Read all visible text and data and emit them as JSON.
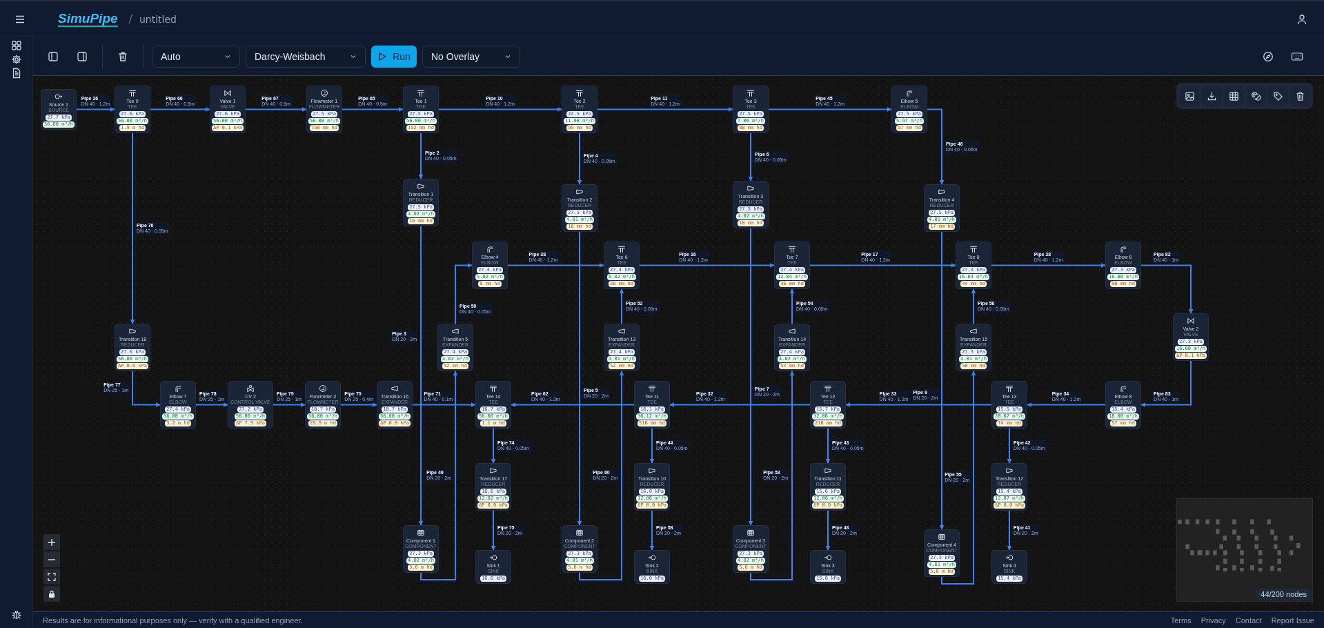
{
  "header": {
    "logo": "SimuPipe",
    "separator": "/",
    "document_title": "untitled"
  },
  "toolbar": {
    "solver_mode": "Auto",
    "friction_model": "Darcy-Weisbach",
    "run_button": "Run",
    "overlay": "No Overlay"
  },
  "nodes": [
    {
      "name": "Source 1",
      "type_label": "SOURCE",
      "kind": "source",
      "readings": [
        "27.7 kPa",
        "56.00 m³/h"
      ]
    },
    {
      "name": "Tee 9",
      "type_label": "TEE",
      "kind": "tee",
      "readings": [
        "27.6 kPa",
        "56.00 m³/h",
        "1.9 m hd"
      ]
    },
    {
      "name": "Valve 1",
      "type_label": "VALVE",
      "kind": "valve",
      "readings": [
        "27.6 kPa",
        "56.00 m³/h",
        "ΔP 0.1 kPa"
      ]
    },
    {
      "name": "Flowmeter 1",
      "type_label": "FLOWMETER",
      "kind": "flowmeter",
      "readings": [
        "27.5 kPa",
        "56.00 m³/h",
        "750 mm hd"
      ]
    },
    {
      "name": "Tee 1",
      "type_label": "TEE",
      "kind": "tee",
      "readings": [
        "27.5 kPa",
        "56.00 m³/h",
        "152 mm hd"
      ]
    },
    {
      "name": "Tee 2",
      "type_label": "TEE",
      "kind": "tee",
      "readings": [
        "22.5 kPa",
        "11.98 m³/h",
        "95 mm hd"
      ]
    },
    {
      "name": "Tee 3",
      "type_label": "TEE",
      "kind": "tee",
      "readings": [
        "27.5 kPa",
        "7.06 m³/h",
        "88 mm hd"
      ]
    },
    {
      "name": "Elbow 5",
      "type_label": "ELBOW",
      "kind": "elbow",
      "readings": [
        "27.5 kPa",
        "5.97 m³/h",
        "57 mm hd"
      ]
    },
    {
      "name": "Transition 1",
      "type_label": "REDUCER",
      "kind": "reducer",
      "readings": [
        "27.5 kPa",
        "4.02 m³/h",
        "16 mm hd"
      ]
    },
    {
      "name": "Transition 2",
      "type_label": "REDUCER",
      "kind": "reducer",
      "readings": [
        "27.5 kPa",
        "4.01 m³/h",
        "18 mm hd"
      ]
    },
    {
      "name": "Transition 3",
      "type_label": "REDUCER",
      "kind": "reducer",
      "readings": [
        "27.5 kPa",
        "4.02 m³/h",
        "18 mm hd"
      ]
    },
    {
      "name": "Transition 4",
      "type_label": "REDUCER",
      "kind": "reducer",
      "readings": [
        "27.5 kPa",
        "4.01 m³/h",
        "17 mm hd"
      ]
    },
    {
      "name": "Elbow 4",
      "type_label": "ELBOW",
      "kind": "elbow",
      "readings": [
        "27.4 kPa",
        "5.02 m³/h",
        "9 mm hd"
      ]
    },
    {
      "name": "Tee 6",
      "type_label": "TEE",
      "kind": "tee",
      "readings": [
        "27.4 kPa",
        "8.02 m³/h",
        "28 mm hd"
      ]
    },
    {
      "name": "Tee 7",
      "type_label": "TEE",
      "kind": "tee",
      "readings": [
        "27.4 kPa",
        "12.04 m³/h",
        "36 mm hd"
      ]
    },
    {
      "name": "Tee 8",
      "type_label": "TEE",
      "kind": "tee",
      "readings": [
        "27.3 kPa",
        "16.04 m³/h",
        "44 mm hd"
      ]
    },
    {
      "name": "Elbow 6",
      "type_label": "ELBOW",
      "kind": "elbow",
      "readings": [
        "27.3 kPa",
        "16.00 m³/h",
        "90 mm hd"
      ]
    },
    {
      "name": "Transition 18",
      "type_label": "REDUCER",
      "kind": "reducer",
      "readings": [
        "27.6 kPa",
        "56.00 m³/h",
        "ΔP 0.0 kPa"
      ]
    },
    {
      "name": "Transition 5",
      "type_label": "EXPANDER",
      "kind": "expander",
      "readings": [
        "27.4 kPa",
        "4.02 m³/h",
        "52 mm hd"
      ]
    },
    {
      "name": "Transition 13",
      "type_label": "EXPANDER",
      "kind": "expander",
      "readings": [
        "27.4 kPa",
        "4.01 m³/h",
        "52 mm hd"
      ]
    },
    {
      "name": "Transition 14",
      "type_label": "EXPANDER",
      "kind": "expander",
      "readings": [
        "27.4 kPa",
        "4.02 m³/h",
        "52 mm hd"
      ]
    },
    {
      "name": "Transition 15",
      "type_label": "EXPANDER",
      "kind": "expander",
      "readings": [
        "27.3 kPa",
        "4.01 m³/h",
        "50 mm hd"
      ]
    },
    {
      "name": "Valve 2",
      "type_label": "VALVE",
      "kind": "valve",
      "readings": [
        "27.3 kPa",
        "16.00 m³/h",
        "ΔP 0.1 kPa"
      ]
    },
    {
      "name": "Elbow 7",
      "type_label": "ELBOW",
      "kind": "elbow",
      "readings": [
        "27.4 kPa",
        "56.00 m³/h",
        "3.2 m hd"
      ]
    },
    {
      "name": "CV 2",
      "type_label": "CONTROL VALVE",
      "kind": "control_valve",
      "readings": [
        "27.2 kPa",
        "56.00 m³/h",
        "ΔP 7.9 kPa"
      ]
    },
    {
      "name": "Flowmeter 2",
      "type_label": "FLOWMETER",
      "kind": "flowmeter",
      "readings": [
        "18.7 kPa",
        "56.00 m³/h",
        "29.9 m hd"
      ]
    },
    {
      "name": "Transition 16",
      "type_label": "EXPANDER",
      "kind": "expander",
      "readings": [
        "18.7 kPa",
        "56.00 m³/h",
        "ΔP 0.0 kPa"
      ]
    },
    {
      "name": "Tee 14",
      "type_label": "TEE",
      "kind": "tee",
      "readings": [
        "16.7 kPa",
        "56.00 m³/h",
        "1.1 m hd"
      ]
    },
    {
      "name": "Tee 11",
      "type_label": "TEE",
      "kind": "tee",
      "readings": [
        "16.1 kPa",
        "36.12 m³/h",
        "516 mm hd"
      ]
    },
    {
      "name": "Tee 12",
      "type_label": "TEE",
      "kind": "tee",
      "readings": [
        "15.7 kPa",
        "32.06 m³/h",
        "216 mm hd"
      ]
    },
    {
      "name": "Tee 13",
      "type_label": "TEE",
      "kind": "tee",
      "readings": [
        "15.5 kPa",
        "20.07 m³/h",
        "74 mm hd"
      ]
    },
    {
      "name": "Elbow 8",
      "type_label": "ELBOW",
      "kind": "elbow",
      "readings": [
        "15.4 kPa",
        "16.00 m³/h",
        "57 mm hd"
      ]
    },
    {
      "name": "Transition 17",
      "type_label": "REDUCER",
      "kind": "reducer",
      "readings": [
        "16.6 kPa",
        "12.02 m³/h",
        "ΔP 0.0 kPa"
      ]
    },
    {
      "name": "Transition 10",
      "type_label": "REDUCER",
      "kind": "reducer",
      "readings": [
        "16.0 kPa",
        "12.06 m³/h",
        "ΔP 0.0 kPa"
      ]
    },
    {
      "name": "Transition 11",
      "type_label": "REDUCER",
      "kind": "reducer",
      "readings": [
        "15.6 kPa",
        "12.06 m³/h",
        "ΔP 0.0 kPa"
      ]
    },
    {
      "name": "Transition 12",
      "type_label": "REDUCER",
      "kind": "reducer",
      "readings": [
        "15.4 kPa",
        "12.07 m³/h",
        "ΔP 0.0 kPa"
      ]
    },
    {
      "name": "Component 1",
      "type_label": "COMPONENT",
      "kind": "component",
      "readings": [
        "27.3 kPa",
        "4.02 m³/h",
        "5.6 m hd"
      ]
    },
    {
      "name": "Sink 1",
      "type_label": "SINK",
      "kind": "sink",
      "readings": [
        "16.6 kPa"
      ]
    },
    {
      "name": "Component 2",
      "type_label": "COMPONENT",
      "kind": "component",
      "readings": [
        "27.3 kPa",
        "4.01 m³/h",
        "5.6 m hd"
      ]
    },
    {
      "name": "Sink 2",
      "type_label": "SINK",
      "kind": "sink",
      "readings": [
        "16.0 kPa"
      ]
    },
    {
      "name": "Component 3",
      "type_label": "COMPONENT",
      "kind": "component",
      "readings": [
        "27.3 kPa",
        "4.02 m³/h",
        "5.6 m hd"
      ]
    },
    {
      "name": "Sink 3",
      "type_label": "SINK",
      "kind": "sink",
      "readings": [
        "15.6 kPa"
      ]
    },
    {
      "name": "Component 4",
      "type_label": "COMPONENT",
      "kind": "component",
      "readings": [
        "27.3 kPa",
        "4.01 m³/h",
        "5.6 m hd"
      ]
    },
    {
      "name": "Sink 4",
      "type_label": "SINK",
      "kind": "sink",
      "readings": [
        "15.4 kPa"
      ]
    }
  ],
  "pipes": [
    {
      "name": "Pipe 26",
      "spec": "DN 40 · 1.2m"
    },
    {
      "name": "Pipe 66",
      "spec": "DN 40 · 0.5m"
    },
    {
      "name": "Pipe 67",
      "spec": "DN 40 · 0.5m"
    },
    {
      "name": "Pipe 65",
      "spec": "DN 40 · 0.5m"
    },
    {
      "name": "Pipe 10",
      "spec": "DN 40 · 1.2m"
    },
    {
      "name": "Pipe 11",
      "spec": "DN 40 · 1.2m"
    },
    {
      "name": "Pipe 45",
      "spec": "DN 40 · 1.2m"
    },
    {
      "name": "Pipe 46",
      "spec": "DN 40 · 0.05m"
    },
    {
      "name": "Pipe 2",
      "spec": "DN 40 · 0.05m"
    },
    {
      "name": "Pipe 4",
      "spec": "DN 40 · 0.05m"
    },
    {
      "name": "Pipe 6",
      "spec": "DN 40 · 0.05m"
    },
    {
      "name": "Pipe 76",
      "spec": "DN 40 · 0.05m"
    },
    {
      "name": "Pipe 3",
      "spec": "DN 20 · 2m"
    },
    {
      "name": "Pipe 5",
      "spec": "DN 20 · 2m"
    },
    {
      "name": "Pipe 7",
      "spec": "DN 20 · 2m"
    },
    {
      "name": "Pipe 9",
      "spec": "DN 20 · 2m"
    },
    {
      "name": "Pipe 38",
      "spec": "DN 40 · 1.2m"
    },
    {
      "name": "Pipe 16",
      "spec": "DN 40 · 1.2m"
    },
    {
      "name": "Pipe 17",
      "spec": "DN 40 · 1.2m"
    },
    {
      "name": "Pipe 28",
      "spec": "DN 40 · 1.2m"
    },
    {
      "name": "Pipe 82",
      "spec": "DN 40 · 1m"
    },
    {
      "name": "Pipe 50",
      "spec": "DN 40 · 0.05m"
    },
    {
      "name": "Pipe 52",
      "spec": "DN 40 · 0.05m"
    },
    {
      "name": "Pipe 54",
      "spec": "DN 40 · 0.05m"
    },
    {
      "name": "Pipe 56",
      "spec": "DN 40 · 0.05m"
    },
    {
      "name": "Pipe 77",
      "spec": "DN 25 · 1m"
    },
    {
      "name": "Pipe 78",
      "spec": "DN 25 · 1m"
    },
    {
      "name": "Pipe 79",
      "spec": "DN 25 · 1m"
    },
    {
      "name": "Pipe 70",
      "spec": "DN 25 · 0.4m"
    },
    {
      "name": "Pipe 71",
      "spec": "DN 40 · 0.1m"
    },
    {
      "name": "Pipe 62",
      "spec": "DN 40 · 1.2m"
    },
    {
      "name": "Pipe 32",
      "spec": "DN 40 · 1.2m"
    },
    {
      "name": "Pipe 33",
      "spec": "DN 40 · 1.2m"
    },
    {
      "name": "Pipe 34",
      "spec": "DN 40 · 1.2m"
    },
    {
      "name": "Pipe 83",
      "spec": "DN 40 · 1m"
    },
    {
      "name": "Pipe 74",
      "spec": "DN 40 · 0.05m"
    },
    {
      "name": "Pipe 44",
      "spec": "DN 40 · 0.05m"
    },
    {
      "name": "Pipe 43",
      "spec": "DN 40 · 0.05m"
    },
    {
      "name": "Pipe 42",
      "spec": "DN 40 · 0.05m"
    },
    {
      "name": "Pipe 75",
      "spec": "DN 20 · 2m"
    },
    {
      "name": "Pipe 58",
      "spec": "DN 20 · 2m"
    },
    {
      "name": "Pipe 48",
      "spec": "DN 20 · 2m"
    },
    {
      "name": "Pipe 41",
      "spec": "DN 20 · 2m"
    },
    {
      "name": "Pipe 49",
      "spec": "DN 20 · 2m"
    },
    {
      "name": "Pipe 60",
      "spec": "DN 20 · 2m"
    },
    {
      "name": "Pipe 53",
      "spec": "DN 20 · 2m"
    },
    {
      "name": "Pipe 55",
      "spec": "DN 20 · 2m"
    }
  ],
  "minimap": {
    "node_count": "44/200 nodes"
  },
  "footer": {
    "disclaimer": "Results are for informational purposes only — verify with a qualified engineer.",
    "links": [
      "Terms",
      "Privacy",
      "Contact",
      "Report Issue"
    ]
  }
}
